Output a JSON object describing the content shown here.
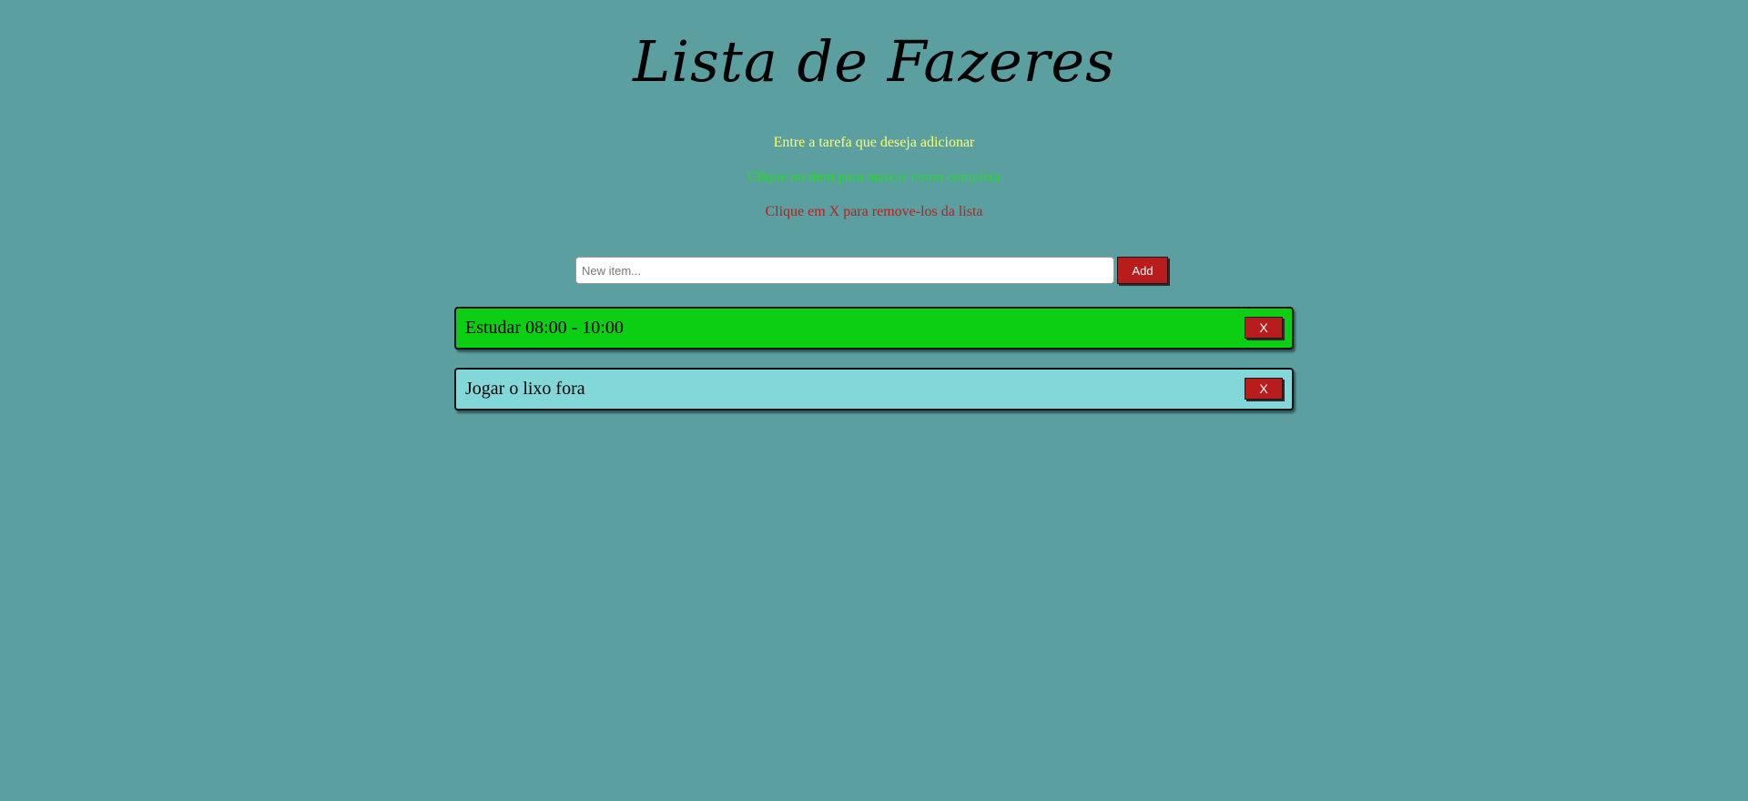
{
  "app": {
    "title": "Lista de Fazeres"
  },
  "instructions": {
    "add": "Entre a tarefa que deseja adicionar",
    "complete": "Clique no item para marcar como completa",
    "remove": "Clique em X para remove-los da lista"
  },
  "form": {
    "placeholder": "New item...",
    "value": "",
    "add_label": "Add"
  },
  "todos": [
    {
      "text": "Estudar 08:00 - 10:00",
      "status": "completed",
      "remove_label": "X"
    },
    {
      "text": "Jogar o lixo fora",
      "status": "pending",
      "remove_label": "X"
    }
  ],
  "colors": {
    "background": "#5b9fa0",
    "completed_item": "#0ccf14",
    "pending_item": "#82d8d8",
    "button": "#b81c1c",
    "hint_add": "#ffff66",
    "hint_complete": "#22dd22",
    "hint_remove": "#b82020"
  }
}
